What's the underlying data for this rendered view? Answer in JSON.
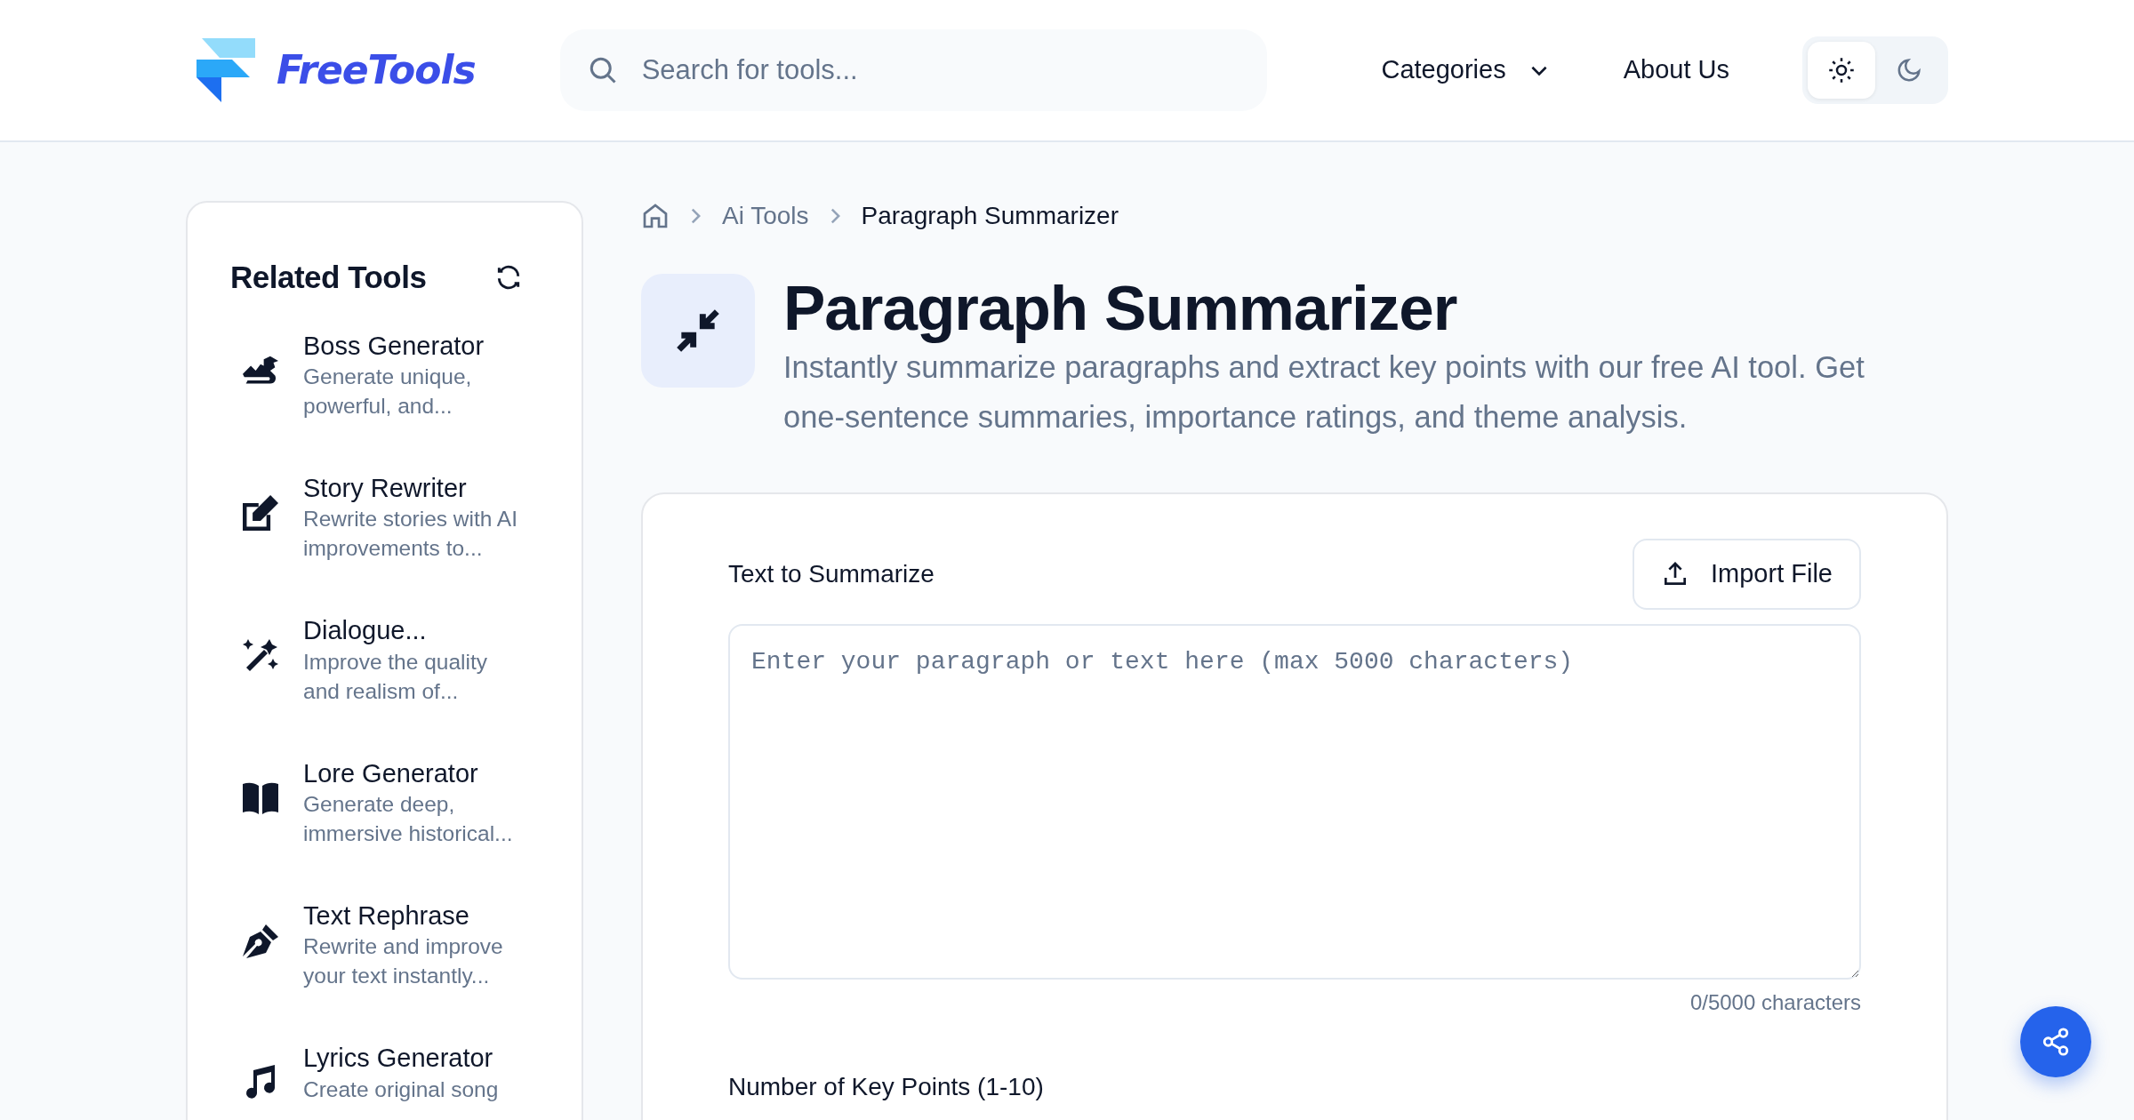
{
  "header": {
    "logo": "FreeTools",
    "search": {
      "placeholder": "Search for tools..."
    },
    "nav": [
      {
        "label": "Categories",
        "kind": "dropdown"
      },
      {
        "label": "About Us",
        "kind": "link"
      }
    ],
    "themes": [
      {
        "kind": "light",
        "selected": true
      },
      {
        "kind": "dark",
        "selected": false
      }
    ]
  },
  "sidebar": {
    "title": "Related Tools",
    "items": [
      {
        "name": "Boss Generator",
        "description": "Generate unique, powerful, and..."
      },
      {
        "name": "Story Rewriter",
        "description": "Rewrite stories with AI improvements to..."
      },
      {
        "name": "Dialogue...",
        "description": "Improve the quality and realism of..."
      },
      {
        "name": "Lore Generator",
        "description": "Generate deep, immersive historical..."
      },
      {
        "name": "Text Rephrase",
        "description": "Rewrite and improve your text instantly..."
      },
      {
        "name": "Lyrics Generator",
        "description": "Create original song"
      }
    ]
  },
  "breadcrumb": [
    {
      "kind": "home"
    },
    {
      "label": "Ai Tools"
    },
    {
      "label": "Paragraph Summarizer"
    }
  ],
  "title": "Paragraph Summarizer",
  "description": "Instantly summarize paragraphs and extract key points with our free AI tool. Get one-sentence summaries, importance ratings, and theme analysis.",
  "form": {
    "text_label": "Text to Summarize",
    "import_button": "Import File",
    "textarea": {
      "placeholder": "Enter your paragraph or text here (max 5000 characters)"
    },
    "counter": "0/5000 characters",
    "key_points_label": "Number of Key Points (1-10)"
  }
}
